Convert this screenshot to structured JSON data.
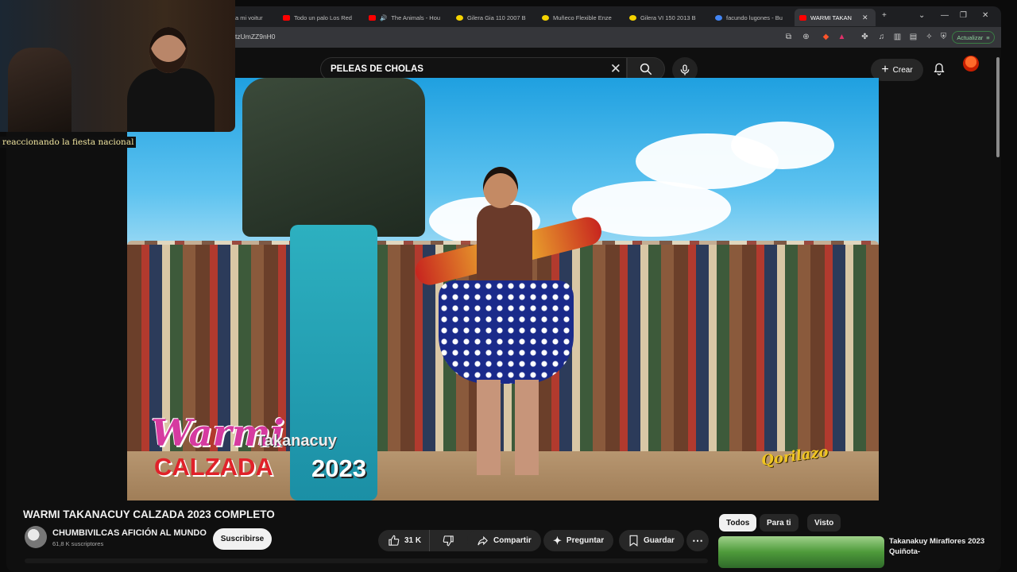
{
  "browser": {
    "tabs": [
      {
        "label": "a mi voitur",
        "color": "#ff0000"
      },
      {
        "label": "Todo un palo Los Red",
        "color": "#ff0000"
      },
      {
        "label": "The Animals - Hou",
        "color": "#ff0000"
      },
      {
        "label": "Gilera Gia 110 2007 B",
        "color": "#f5d300"
      },
      {
        "label": "Muñeco Flexible Enze",
        "color": "#f5d300"
      },
      {
        "label": "Gilera VI 150 2013 B",
        "color": "#f5d300"
      },
      {
        "label": "facundo lugones - Bu",
        "color": "#4285f4"
      },
      {
        "label": "WARMI TAKAN",
        "color": "#ff0000"
      }
    ],
    "new_tab_symbol": "+",
    "url": "tzUmZZ9nH0",
    "update_label": "Actualizar"
  },
  "youtube": {
    "search": {
      "value": "PELEAS DE CHOLAS",
      "clear_symbol": "✕"
    },
    "create_label": "Crear",
    "icons": [
      "search-icon",
      "mic-icon",
      "bell-icon",
      "avatar-icon"
    ]
  },
  "webcam": {
    "caption": "reaccionando la fiesta nacional"
  },
  "video_overlay": {
    "line1": "Warmi",
    "line2": "Takanacuy",
    "line3": "CALZADA",
    "line4": "2023",
    "logo": "Qorilazo"
  },
  "video": {
    "title": "WARMI TAKANACUY CALZADA 2023 COMPLETO",
    "channel": "CHUMBIVILCAS AFICIÓN AL MUNDO",
    "subscribers": "61,8 K suscriptores",
    "subscribe_label": "Suscribirse",
    "likes": "31 K",
    "share_label": "Compartir",
    "ask_label": "Preguntar",
    "save_label": "Guardar",
    "more_symbol": "⋯"
  },
  "recommendations": {
    "chips": [
      "Todos",
      "Para ti",
      "Visto"
    ],
    "selected_chip": "Todos",
    "first_title": "Takanakuy Miraflores 2023 Quiñota-"
  },
  "colors": {
    "yt_bg": "#0f0f0f",
    "chip_selected": "#f1f1f1",
    "pill_bg": "#272727"
  }
}
